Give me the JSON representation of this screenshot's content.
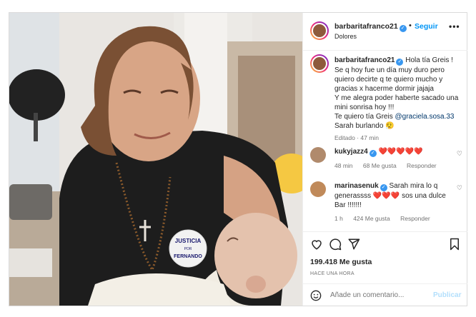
{
  "post": {
    "username": "barbaritafranco21",
    "location": "Dolores",
    "dot": "•",
    "follow_label": "Seguir",
    "more_label": "•••"
  },
  "caption": {
    "username": "barbaritafranco21",
    "lines": [
      "Hola tía Greis !",
      "Se q hoy fue un día muy duro pero quiero decirte q te quiero mucho y gracias x hacerme dormir jajaja",
      "Y me alegra poder haberte sacado una mini sonrisa hoy !!!",
      "Te quiero tía Greis"
    ],
    "mention": "@graciela.sosa.33",
    "signoff": "Sarah burlando",
    "edited": "Editado",
    "time": "47 min"
  },
  "comments": [
    {
      "username": "kukyjazz4",
      "text": "",
      "hearts": 5,
      "time": "48 min",
      "likes": "68 Me gusta",
      "reply": "Responder",
      "avatar_color": "#b08a6c"
    },
    {
      "username": "marinasenuk",
      "text_before": "Sarah mira lo q generassss",
      "text_after": "sos una dulce Bar !!!!!!!",
      "hearts": 3,
      "time": "1 h",
      "likes": "424 Me gusta",
      "reply": "Responder",
      "avatar_color": "#c08a5a"
    }
  ],
  "actions": {
    "likes_count": "199.418 Me gusta",
    "posted_ago": "HACE UNA HORA",
    "comment_placeholder": "Añade un comentario...",
    "publish_label": "Publicar"
  },
  "photo": {
    "badge_line1": "JUSTICIA",
    "badge_line2": "POR",
    "badge_line3": "FERNANDO"
  },
  "colors": {
    "accent": "#0095f6",
    "heart": "#ed4956",
    "verified": "#3897f0"
  }
}
